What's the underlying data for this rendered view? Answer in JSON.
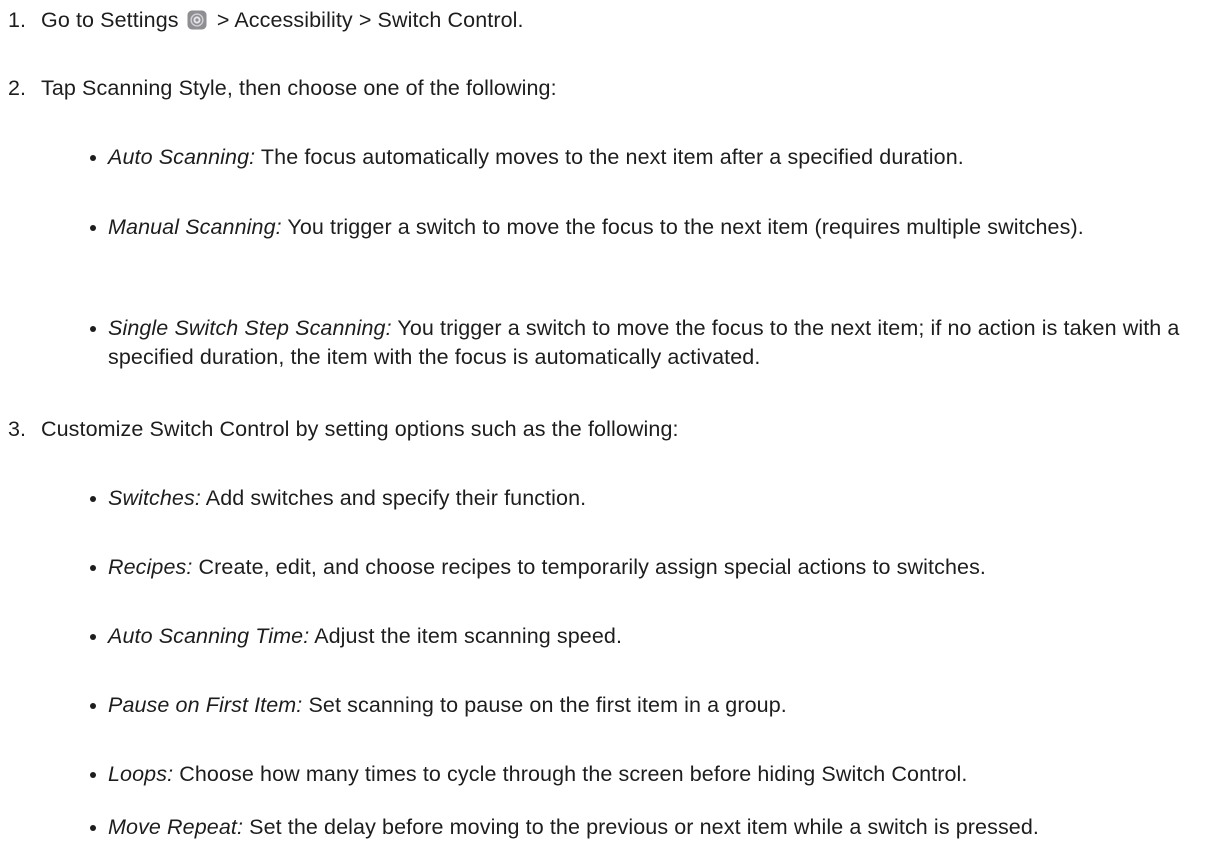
{
  "step1": {
    "number": "1.",
    "text_before_icon": "Go to Settings",
    "icon": "settings-gear-icon",
    "text_after_icon": "> Accessibility > Switch Control."
  },
  "step2": {
    "number": "2.",
    "text": "Tap Scanning Style, then choose one of the following:",
    "bullets": [
      {
        "term": "Auto Scanning:",
        "text": "The focus automatically moves to the next item after a specified duration."
      },
      {
        "term": "Manual Scanning:",
        "text": "You trigger a switch to move the focus to the next item (requires multiple switches)."
      },
      {
        "term": "Single Switch Step Scanning:",
        "text": "You trigger a switch to move the focus to the next item; if no action is taken with a specified duration, the item with the focus is automatically activated."
      }
    ]
  },
  "step3": {
    "number": "3.",
    "text": "Customize Switch Control by setting options such as the following:",
    "bullets": [
      {
        "term": "Switches:",
        "text": "Add switches and specify their function."
      },
      {
        "term": "Recipes:",
        "text": "Create, edit, and choose recipes to temporarily assign special actions to switches."
      },
      {
        "term": "Auto Scanning Time:",
        "text": "Adjust the item scanning speed."
      },
      {
        "term": "Pause on First Item:",
        "text": "Set scanning to pause on the first item in a group."
      },
      {
        "term": "Loops:",
        "text": "Choose how many times to cycle through the screen before hiding Switch Control."
      },
      {
        "term": "Move Repeat:",
        "text": "Set the delay before moving to the previous or next item while a switch is pressed."
      }
    ]
  }
}
